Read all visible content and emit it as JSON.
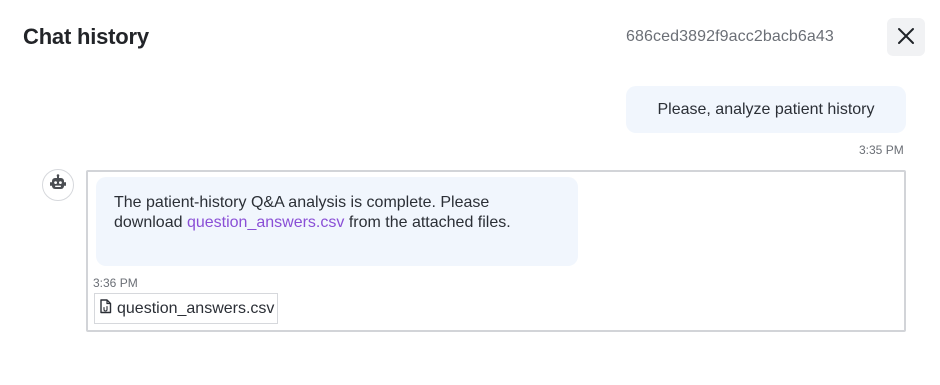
{
  "header": {
    "title": "Chat history",
    "chat_id": "686ced3892f9acc2bacb6a43",
    "close_icon": "close-icon"
  },
  "messages": [
    {
      "role": "user",
      "text": "Please, analyze patient history",
      "time": "3:35 PM"
    },
    {
      "role": "assistant",
      "avatar_icon": "robot-icon",
      "text_before": "The patient-history Q&A analysis is complete. Please download ",
      "link_text": "question_answers.csv",
      "text_after": " from the attached files.",
      "time": "3:36 PM",
      "attachment": {
        "icon": "file-icon",
        "name": "question_answers.csv"
      }
    }
  ],
  "colors": {
    "bubble_bg": "#f1f6fd",
    "link": "#8a4fd6",
    "muted_text": "#6b6f76",
    "frame_border": "#d2d4d8"
  }
}
